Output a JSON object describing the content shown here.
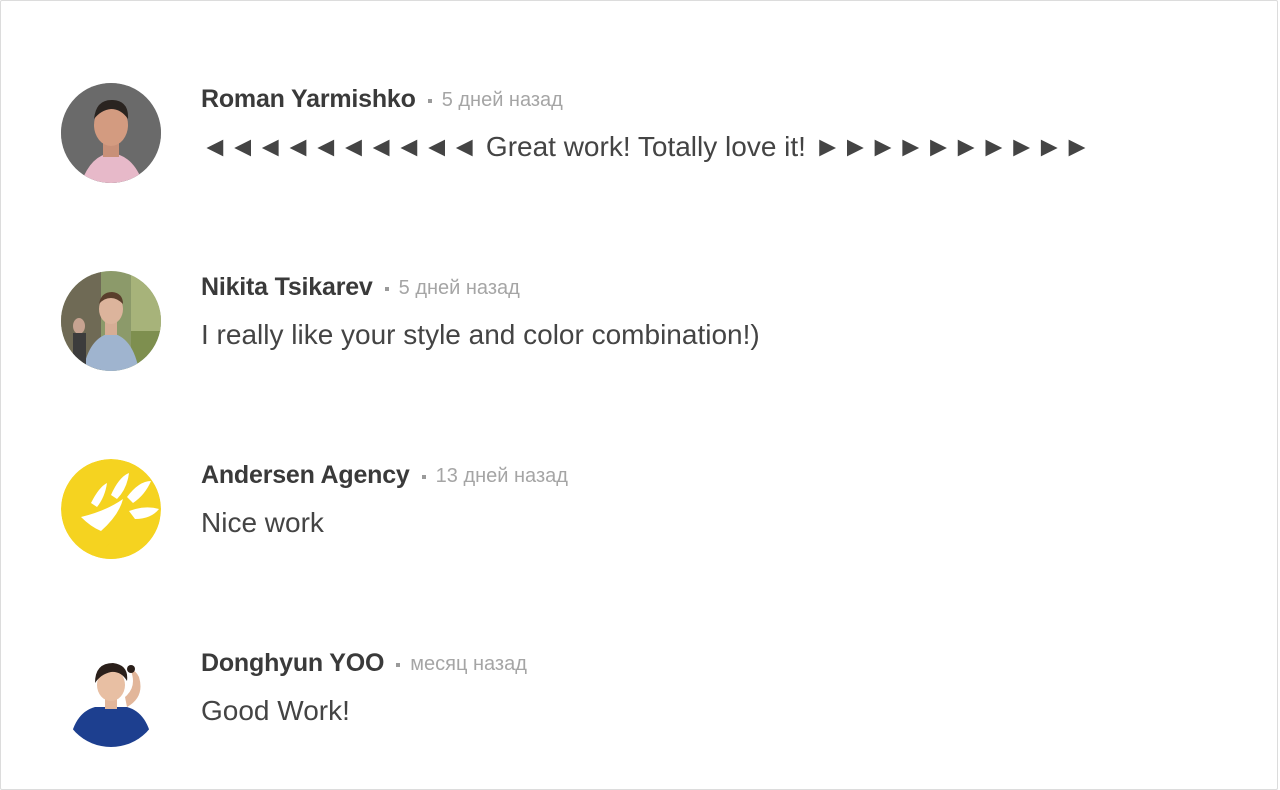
{
  "comments": [
    {
      "author": "Roman Yarmishko",
      "time": "5 дней назад",
      "text": "◄◄◄◄◄◄◄◄◄◄ Great work! Totally love it! ►►►►►►►►►►",
      "avatar_icon": "avatar-photo-man-gray-bg"
    },
    {
      "author": "Nikita Tsikarev",
      "time": "5 дней назад",
      "text": "I really like your style and color combination!)",
      "avatar_icon": "avatar-photo-young-man-outdoors"
    },
    {
      "author": "Andersen Agency",
      "time": "13 дней назад",
      "text": "Nice work",
      "avatar_icon": "avatar-logo-yellow-sun",
      "logo_color": "#f5d320"
    },
    {
      "author": "Donghyun YOO",
      "time": "месяц назад",
      "text": "Good Work!",
      "avatar_icon": "avatar-illustration-man-blue-shirt"
    }
  ]
}
